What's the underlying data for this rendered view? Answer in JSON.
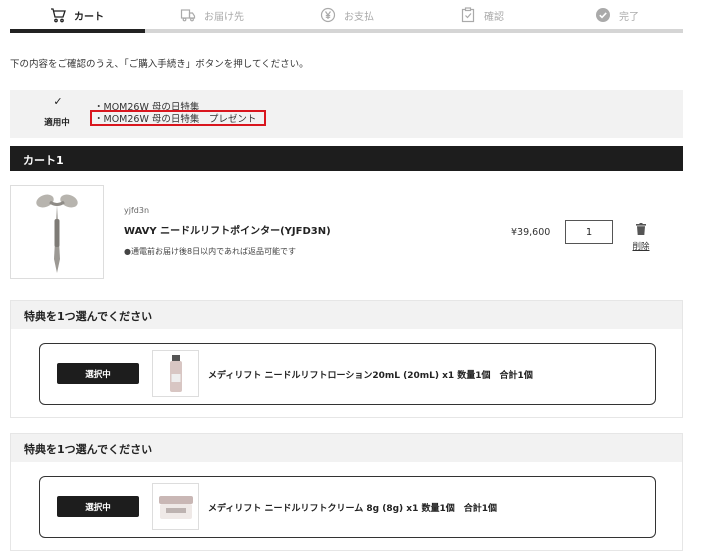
{
  "steps": [
    {
      "label": "カート",
      "icon": "cart-icon",
      "active": true
    },
    {
      "label": "お届け先",
      "icon": "truck-icon",
      "active": false
    },
    {
      "label": "お支払",
      "icon": "yen-icon",
      "active": false
    },
    {
      "label": "確認",
      "icon": "clipboard-check-icon",
      "active": false
    },
    {
      "label": "完了",
      "icon": "check-circle-icon",
      "active": false
    }
  ],
  "intro": "下の内容をご確認のうえ、「ご購入手続き」ボタンを押してください。",
  "coupon": {
    "check": "✓",
    "status": "適用中",
    "lines": [
      "・MOM26W 母の日特集",
      "・MOM26W 母の日特集　プレゼント"
    ]
  },
  "cart": {
    "title": "カート1",
    "product": {
      "code": "yjfd3n",
      "name": "WAVY ニードルリフトポインター(YJFD3N)",
      "note": "●通電前お届け後8日以内であれば返品可能です",
      "price": "¥39,600",
      "quantity": "1",
      "delete_label": "削除"
    }
  },
  "benefits": [
    {
      "title": "特典を1つ選んでください",
      "select_label": "選択中",
      "item": "メディリフト ニードルリフトローション20mL (20mL) x1 数量1個　合計1個"
    },
    {
      "title": "特典を1つ選んでください",
      "select_label": "選択中",
      "item": "メディリフト ニードルリフトクリーム 8g (8g) x1 数量1個　合計1個"
    }
  ],
  "colors": {
    "accent_dark": "#1d1d1d",
    "highlight_red": "#d9161e",
    "muted": "#aaaaaa"
  }
}
